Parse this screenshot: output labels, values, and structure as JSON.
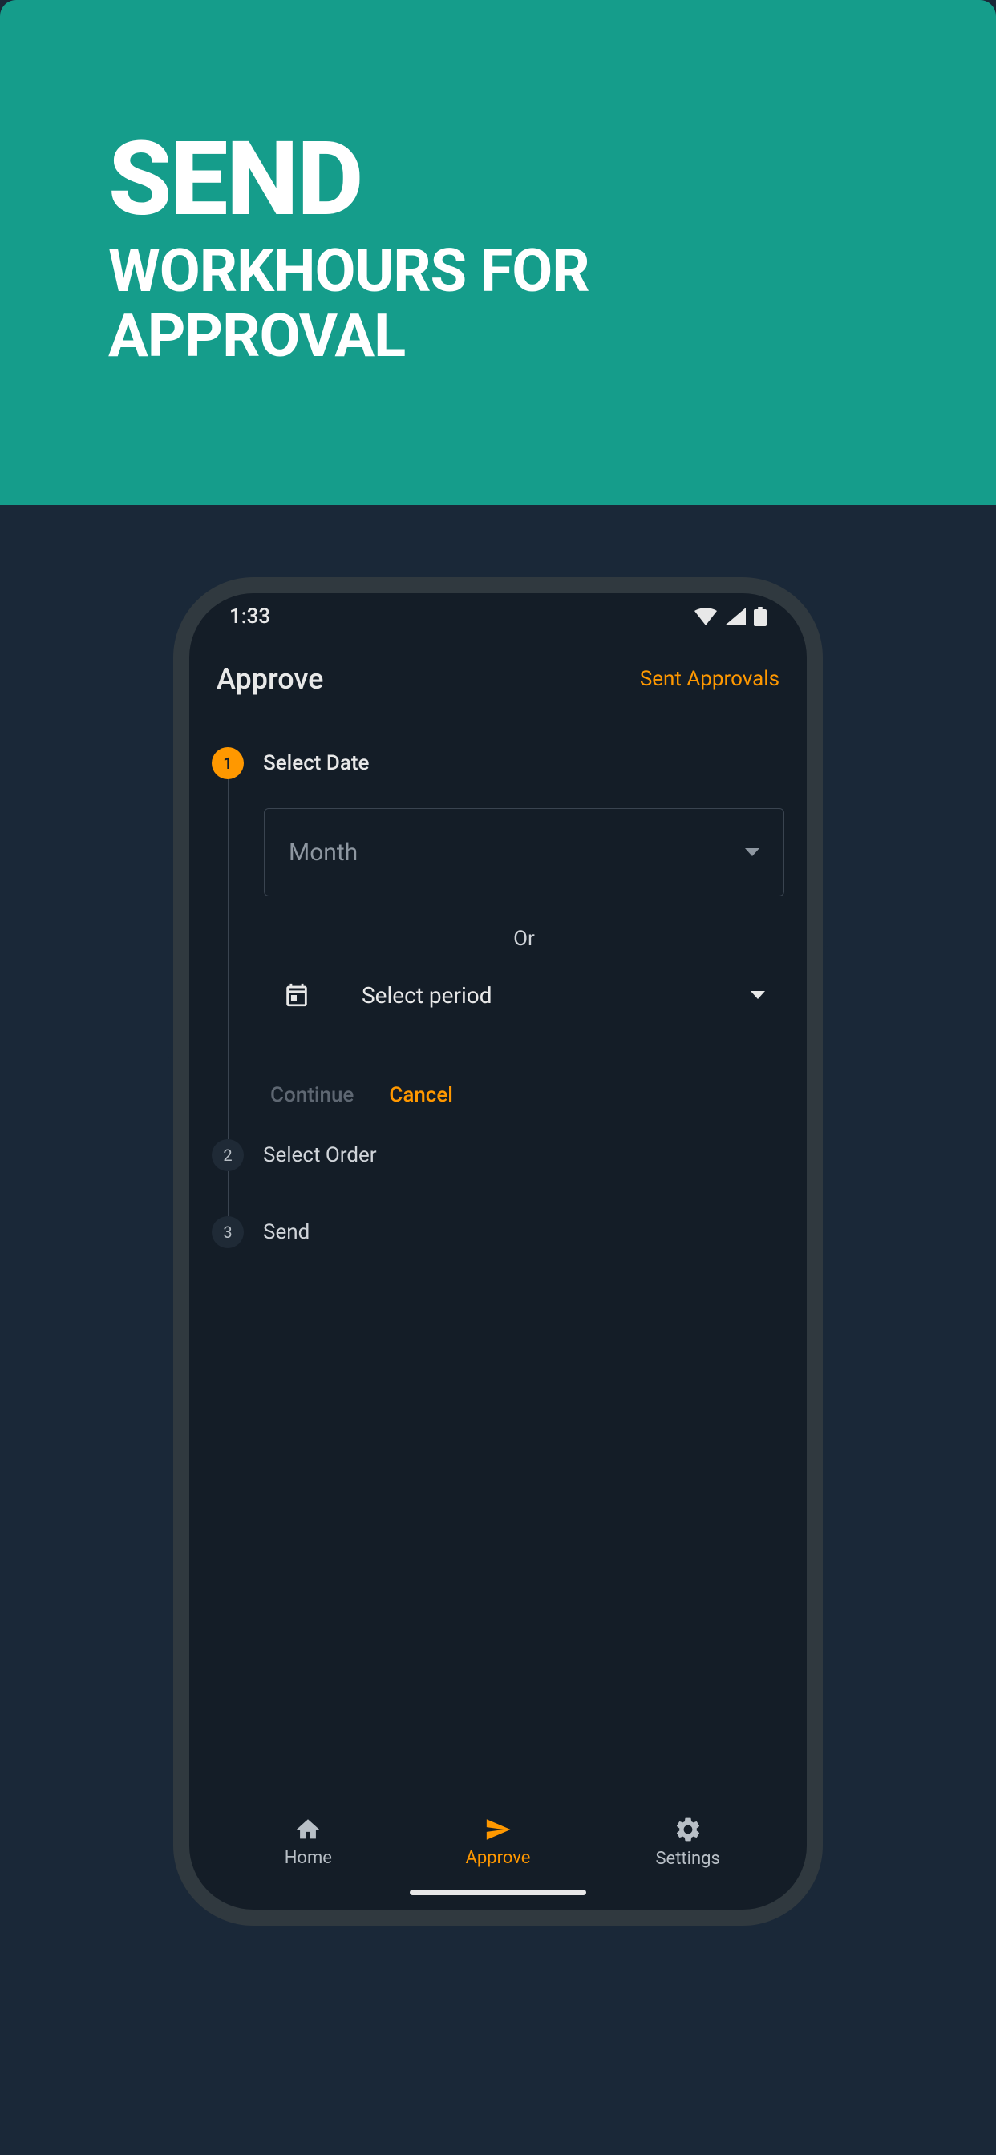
{
  "hero": {
    "line1": "SEND",
    "line2": "WORKHOURS FOR APPROVAL"
  },
  "statusbar": {
    "time": "1:33"
  },
  "appbar": {
    "title": "Approve",
    "action": "Sent Approvals"
  },
  "stepper": {
    "step1": {
      "num": "1",
      "label": "Select Date",
      "monthPlaceholder": "Month",
      "or": "Or",
      "periodLabel": "Select period",
      "continue": "Continue",
      "cancel": "Cancel"
    },
    "step2": {
      "num": "2",
      "label": "Select Order"
    },
    "step3": {
      "num": "3",
      "label": "Send"
    }
  },
  "nav": {
    "home": "Home",
    "approve": "Approve",
    "settings": "Settings"
  }
}
